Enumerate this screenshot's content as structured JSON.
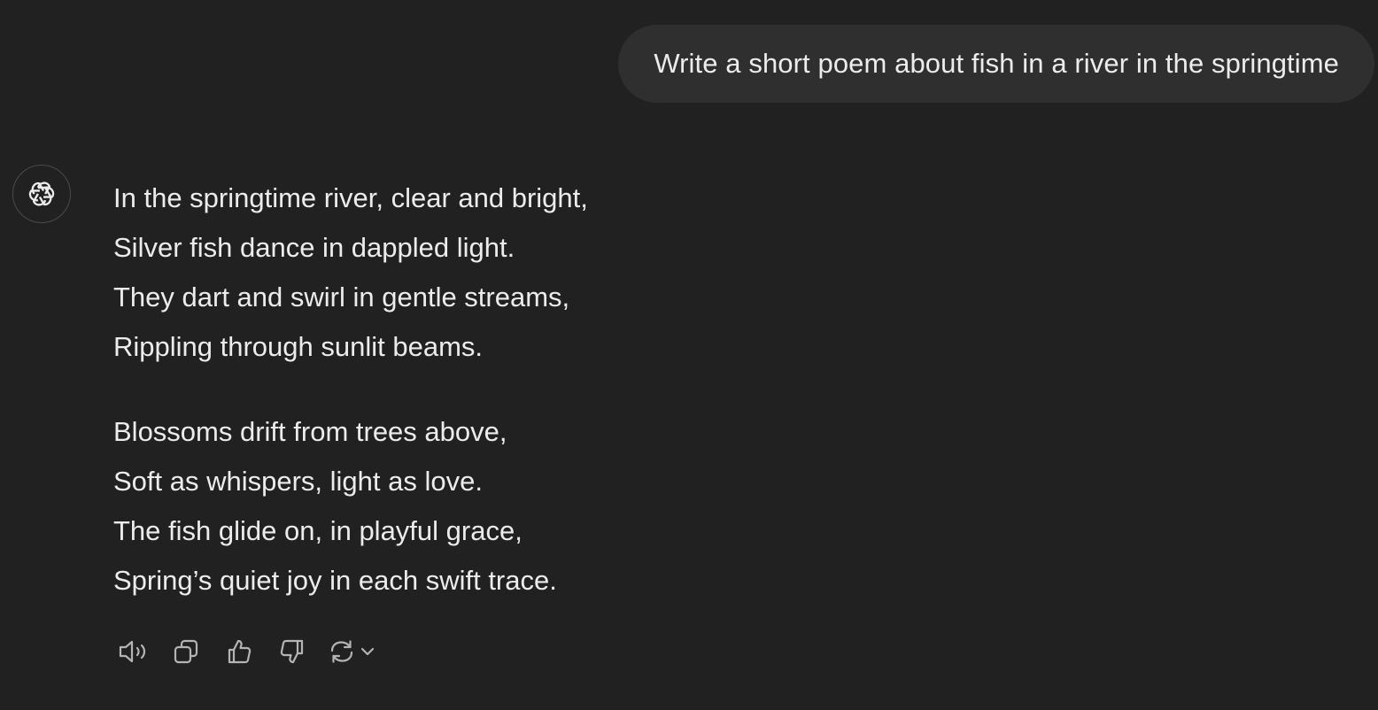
{
  "user_message": {
    "text": "Write a short poem about fish in a river in the springtime"
  },
  "assistant": {
    "avatar_icon": "openai-logo-icon",
    "stanzas": [
      {
        "lines": [
          "In the springtime river, clear and bright,",
          "Silver fish dance in dappled light.",
          "They dart and swirl in gentle streams,",
          "Rippling through sunlit beams."
        ]
      },
      {
        "lines": [
          "Blossoms drift from trees above,",
          "Soft as whispers, light as love.",
          "The fish glide on, in playful grace,",
          "Spring’s quiet joy in each swift trace."
        ]
      }
    ],
    "actions": [
      {
        "icon": "speaker-icon"
      },
      {
        "icon": "copy-icon"
      },
      {
        "icon": "thumbs-up-icon"
      },
      {
        "icon": "thumbs-down-icon"
      },
      {
        "icon": "regenerate-icon"
      }
    ]
  },
  "colors": {
    "background": "#212121",
    "bubble": "#2f2f2f",
    "text": "#ececec",
    "icon": "#b4b4b4"
  }
}
